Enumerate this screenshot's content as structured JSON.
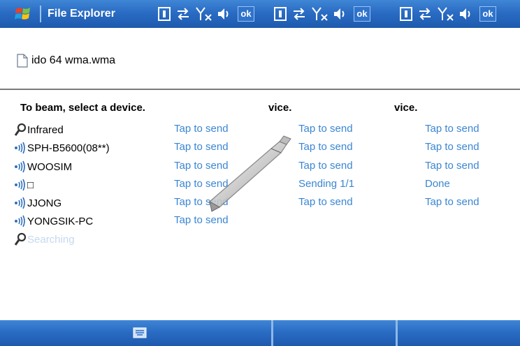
{
  "panels": [
    {
      "title": "File Explorer",
      "ok_label": "ok",
      "file_name": "ido 64 wma.wma",
      "heading": "To beam, select a device.",
      "devices": [
        {
          "name": "Infrared",
          "icon": "search-icon",
          "action": "Tap to send"
        },
        {
          "name": "SPH-B5600(08**)",
          "icon": "bluetooth-device-icon",
          "action": "Tap to send"
        },
        {
          "name": "WOOSIM",
          "icon": "bluetooth-device-icon",
          "action": "Tap to send"
        },
        {
          "name": "□",
          "icon": "bluetooth-device-icon",
          "action": "Tap to send"
        },
        {
          "name": "JJONG",
          "icon": "bluetooth-device-icon",
          "action": "Tap to send"
        },
        {
          "name": "YONGSIK-PC",
          "icon": "bluetooth-device-icon",
          "action": "Tap to send"
        },
        {
          "name": "Searching",
          "icon": "search-icon"
        }
      ]
    },
    {
      "ok_label": "ok",
      "heading": "vice.",
      "actions": [
        "Tap to send",
        "Tap to send",
        "Tap to send",
        "Sending 1/1",
        "Tap to send"
      ]
    },
    {
      "ok_label": "ok",
      "heading": "vice.",
      "actions": [
        "Tap to send",
        "Tap to send",
        "Tap to send",
        "Done",
        "Tap to send"
      ]
    }
  ],
  "colors": {
    "titlebar": "#2a6cc4",
    "link": "#3a86d2",
    "faded_text": "#c5d9ee"
  }
}
